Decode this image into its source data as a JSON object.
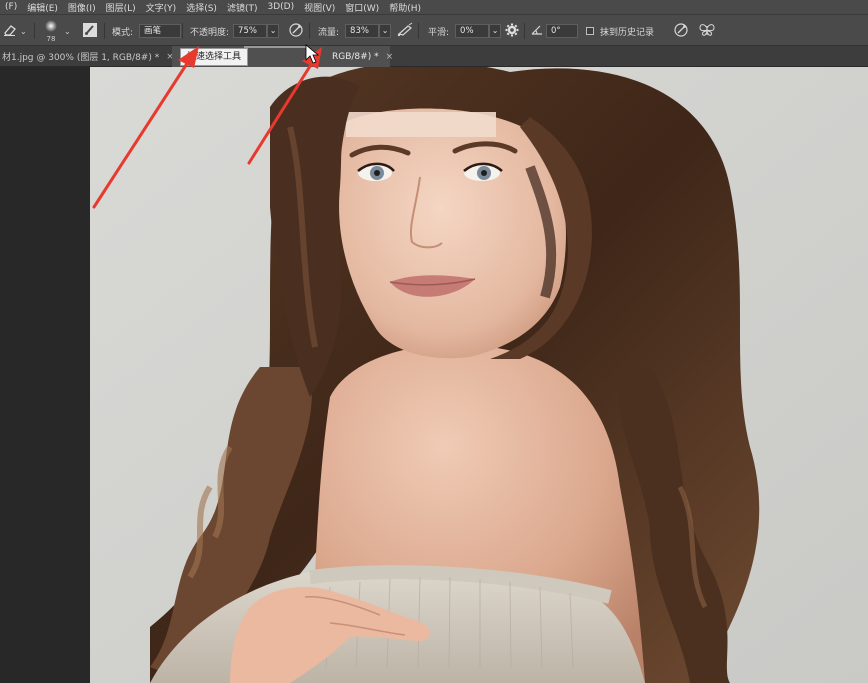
{
  "menu": [
    "(F)",
    "编辑(E)",
    "图像(I)",
    "图层(L)",
    "文字(Y)",
    "选择(S)",
    "滤镜(T)",
    "3D(D)",
    "视图(V)",
    "窗口(W)",
    "帮助(H)"
  ],
  "options": {
    "brush_size": "78",
    "mode_label": "模式:",
    "mode_value": "画笔",
    "opacity_label": "不透明度:",
    "opacity_value": "75%",
    "flow_label": "流量:",
    "flow_value": "83%",
    "smoothing_label": "平滑:",
    "smoothing_value": "0%",
    "angle_value": "0°",
    "erase_history_label": "抹到历史记录",
    "erase_history_checked": false
  },
  "tabs": [
    {
      "label": "材1.jpg @ 300% (图层 1, RGB/8#) *",
      "close": "×",
      "active": false
    },
    {
      "label": "RGB/8#) *",
      "close": "×",
      "active": true
    }
  ],
  "tooltip": {
    "text": "快速选择工具"
  },
  "colors": {
    "app_bg": "#282828",
    "toolbar_bg": "#4a4a4a",
    "canvas_bg": "#d5d5d3",
    "annotation_arrow": "#e8392f"
  },
  "icons": {
    "tool_preset": "eraser-icon",
    "brush_panel": "brush-settings-icon",
    "opacity_pressure": "pressure-opacity-icon",
    "airbrush": "airbrush-icon",
    "settings": "gear-icon",
    "angle": "angle-icon",
    "size_pressure": "pressure-size-icon",
    "symmetry": "butterfly-symmetry-icon"
  }
}
